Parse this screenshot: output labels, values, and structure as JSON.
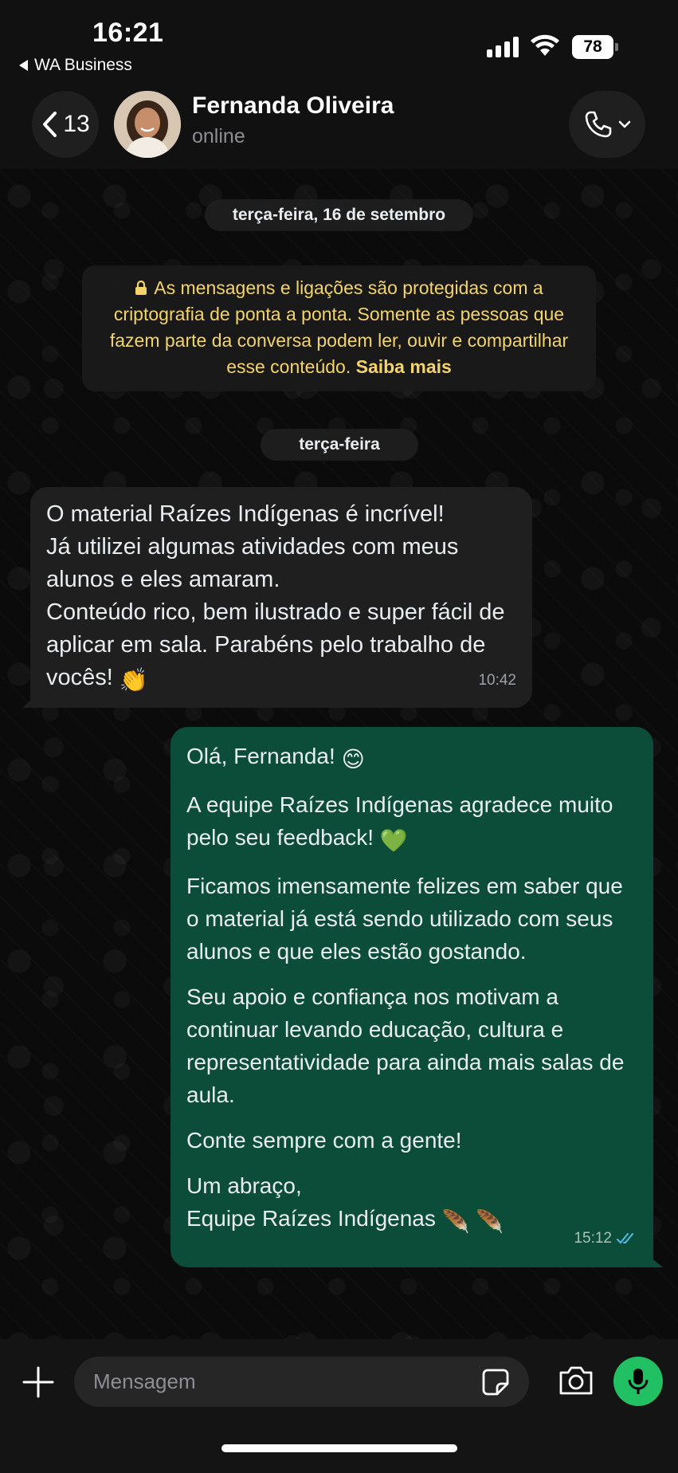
{
  "status_bar": {
    "time": "16:21",
    "back_app": "WA Business",
    "battery": "78"
  },
  "header": {
    "back_count": "13",
    "contact_name": "Fernanda Oliveira",
    "contact_status": "online"
  },
  "chat": {
    "date_separator_1": "terça-feira, 16 de setembro",
    "encryption_notice": "As mensagens e ligações são protegidas com a criptografia de ponta a ponta. Somente as pessoas que fazem parte da conversa podem ler, ouvir e compartilhar esse conteúdo.",
    "encryption_link": "Saiba mais",
    "date_separator_2": "terça-feira",
    "incoming": {
      "line1": "O material Raízes Indígenas é incrível!",
      "line2": "Já utilizei algumas atividades com meus alunos e eles amaram.",
      "line3": "Conteúdo rico, bem ilustrado e super fácil de aplicar em sala. Parabéns pelo trabalho de vocês!",
      "emoji": "👏",
      "time": "10:42"
    },
    "outgoing": {
      "p1": "Olá, Fernanda!",
      "p1_emoji": "😊",
      "p2": "A equipe Raízes Indígenas agradece muito pelo seu feedback!",
      "p2_emoji": "💚",
      "p3": "Ficamos imensamente felizes em saber que o material já está sendo utilizado com seus alunos e que eles estão gostando.",
      "p4": "Seu apoio e confiança nos motivam a continuar levando educação, cultura e representatividade para ainda mais salas de aula.",
      "p5": "Conte sempre com a gente!",
      "p6_line1": "Um abraço,",
      "p6_line2": "Equipe Raízes Indígenas",
      "p6_emoji": "🪶 🪶",
      "time": "15:12",
      "read_status": "read"
    }
  },
  "input": {
    "placeholder": "Mensagem"
  },
  "colors": {
    "outgoing_bubble": "#0b4d38",
    "incoming_bubble": "#1f1f1f",
    "accent_green": "#21c063",
    "encryption_text": "#f3d46b",
    "read_ticks": "#53bdeb"
  }
}
